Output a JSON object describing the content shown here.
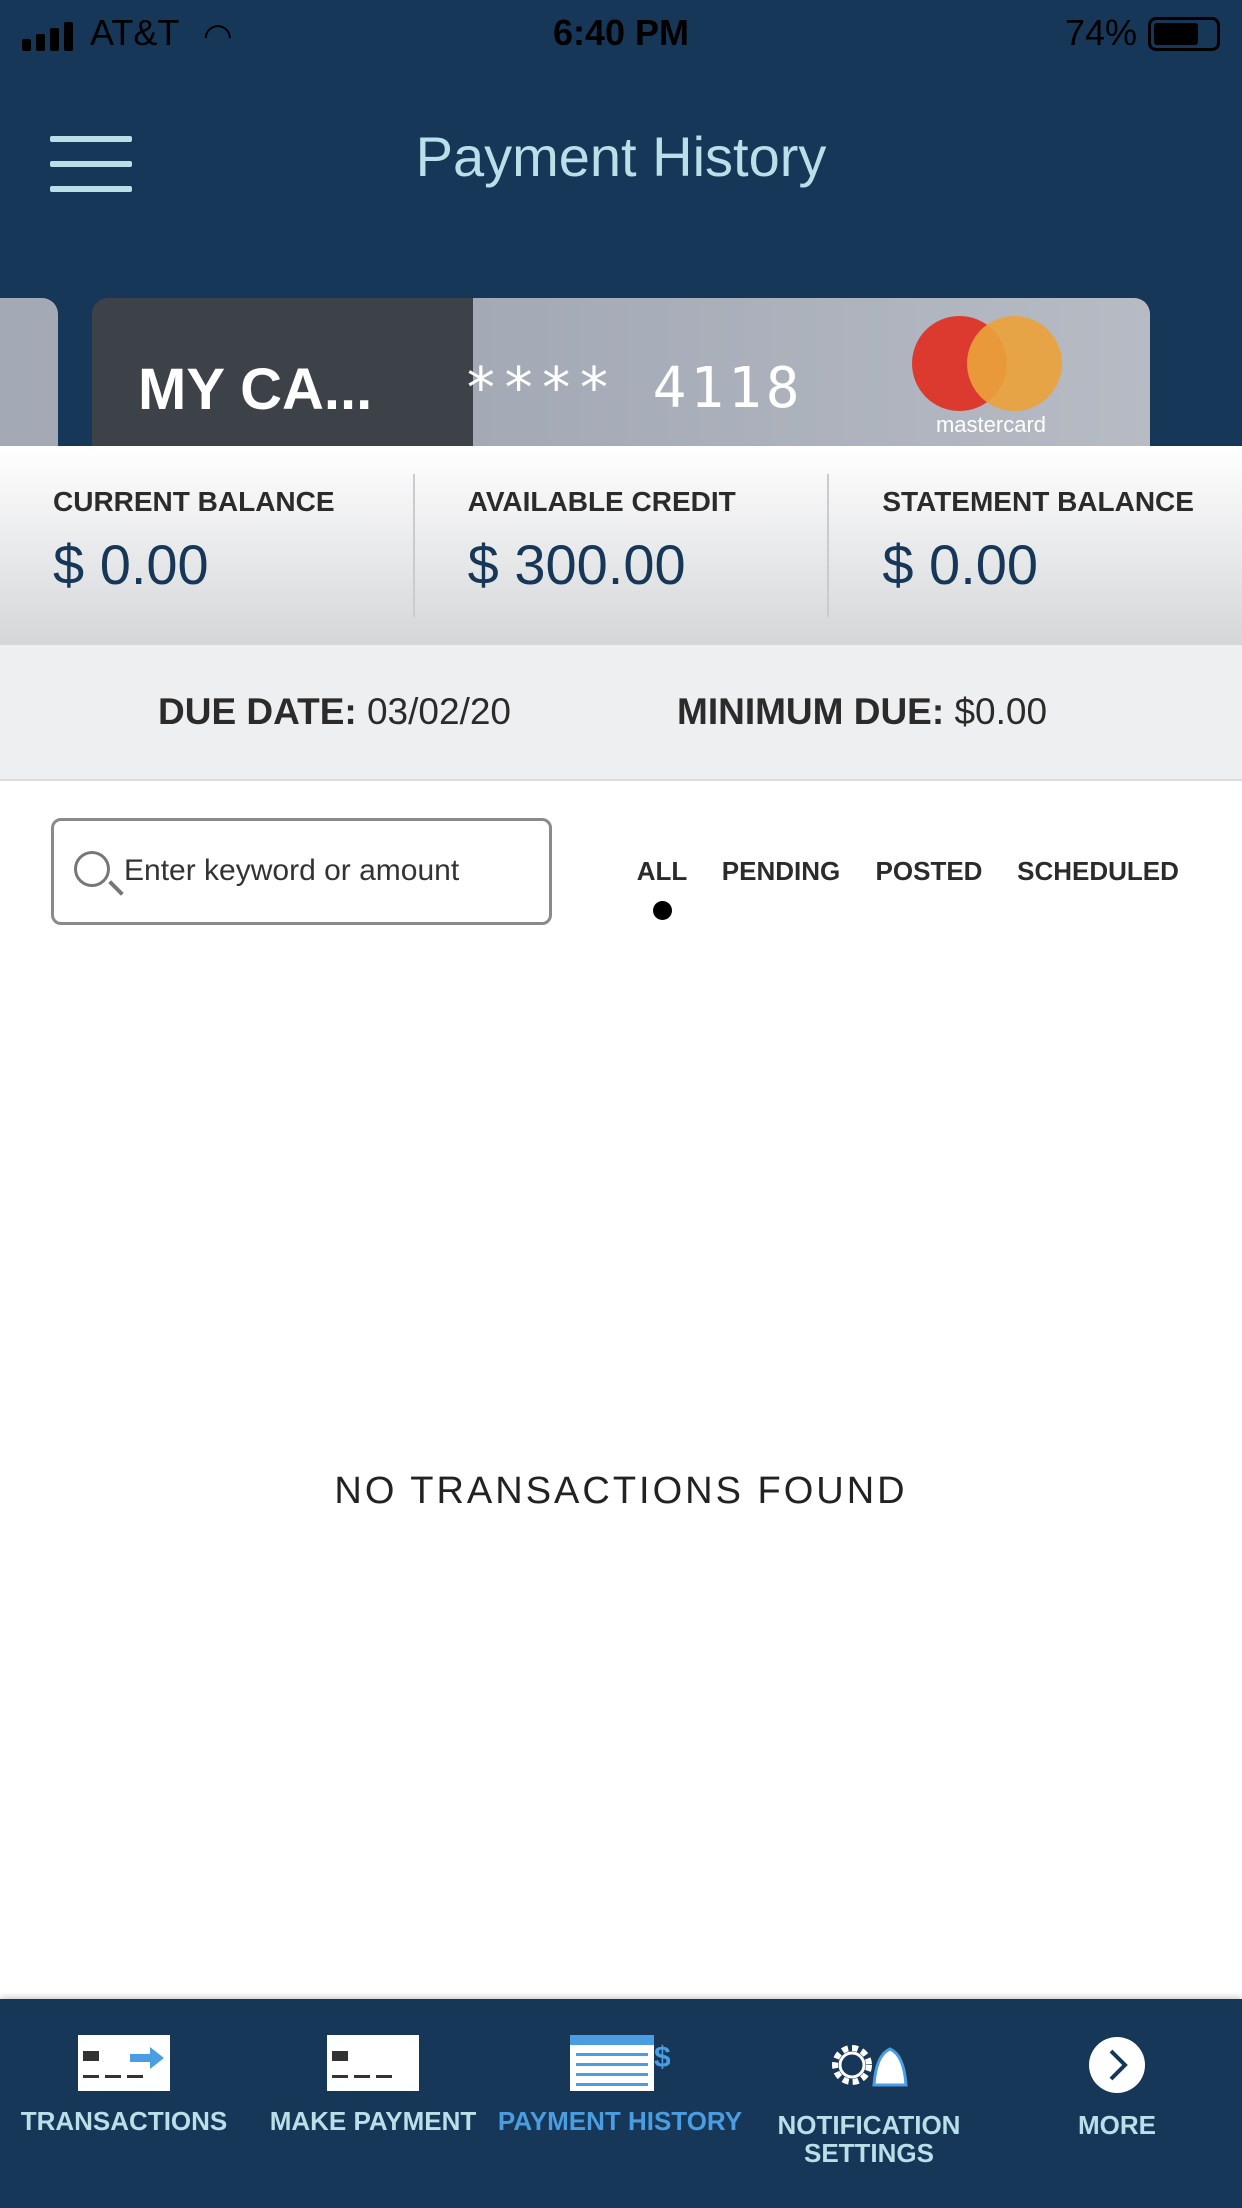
{
  "status_bar": {
    "carrier": "AT&T",
    "time": "6:40 PM",
    "battery": "74%",
    "battery_level": 0.74
  },
  "header": {
    "title": "Payment History"
  },
  "card": {
    "name": "MY CA...",
    "number": "**** 4118",
    "network": "mastercard"
  },
  "balances": [
    {
      "label": "CURRENT BALANCE",
      "value": "$ 0.00"
    },
    {
      "label": "AVAILABLE CREDIT",
      "value": "$ 300.00"
    },
    {
      "label": "STATEMENT BALANCE",
      "value": "$ 0.00"
    }
  ],
  "due": {
    "due_label": "DUE DATE:",
    "due_value": "03/02/20",
    "min_label": "MINIMUM DUE:",
    "min_value": "$0.00"
  },
  "search": {
    "placeholder": "Enter keyword or amount"
  },
  "filters": {
    "tabs": [
      "ALL",
      "PENDING",
      "POSTED",
      "SCHEDULED"
    ],
    "selected": "ALL"
  },
  "empty_message": "NO TRANSACTIONS FOUND",
  "nav": {
    "items": [
      {
        "label": "TRANSACTIONS",
        "icon": "transactions-icon"
      },
      {
        "label": "MAKE PAYMENT",
        "icon": "make-payment-icon"
      },
      {
        "label": "PAYMENT HISTORY",
        "icon": "calendar-dollar-icon",
        "active": true
      },
      {
        "label": "NOTIFICATION SETTINGS",
        "icon": "gear-bell-icon"
      },
      {
        "label": "MORE",
        "icon": "chevron-right-circle-icon"
      }
    ]
  },
  "colors": {
    "primary": "#163757",
    "accent": "#4a9de0",
    "header_text": "#b9dfe8",
    "balance_text": "#163757"
  }
}
